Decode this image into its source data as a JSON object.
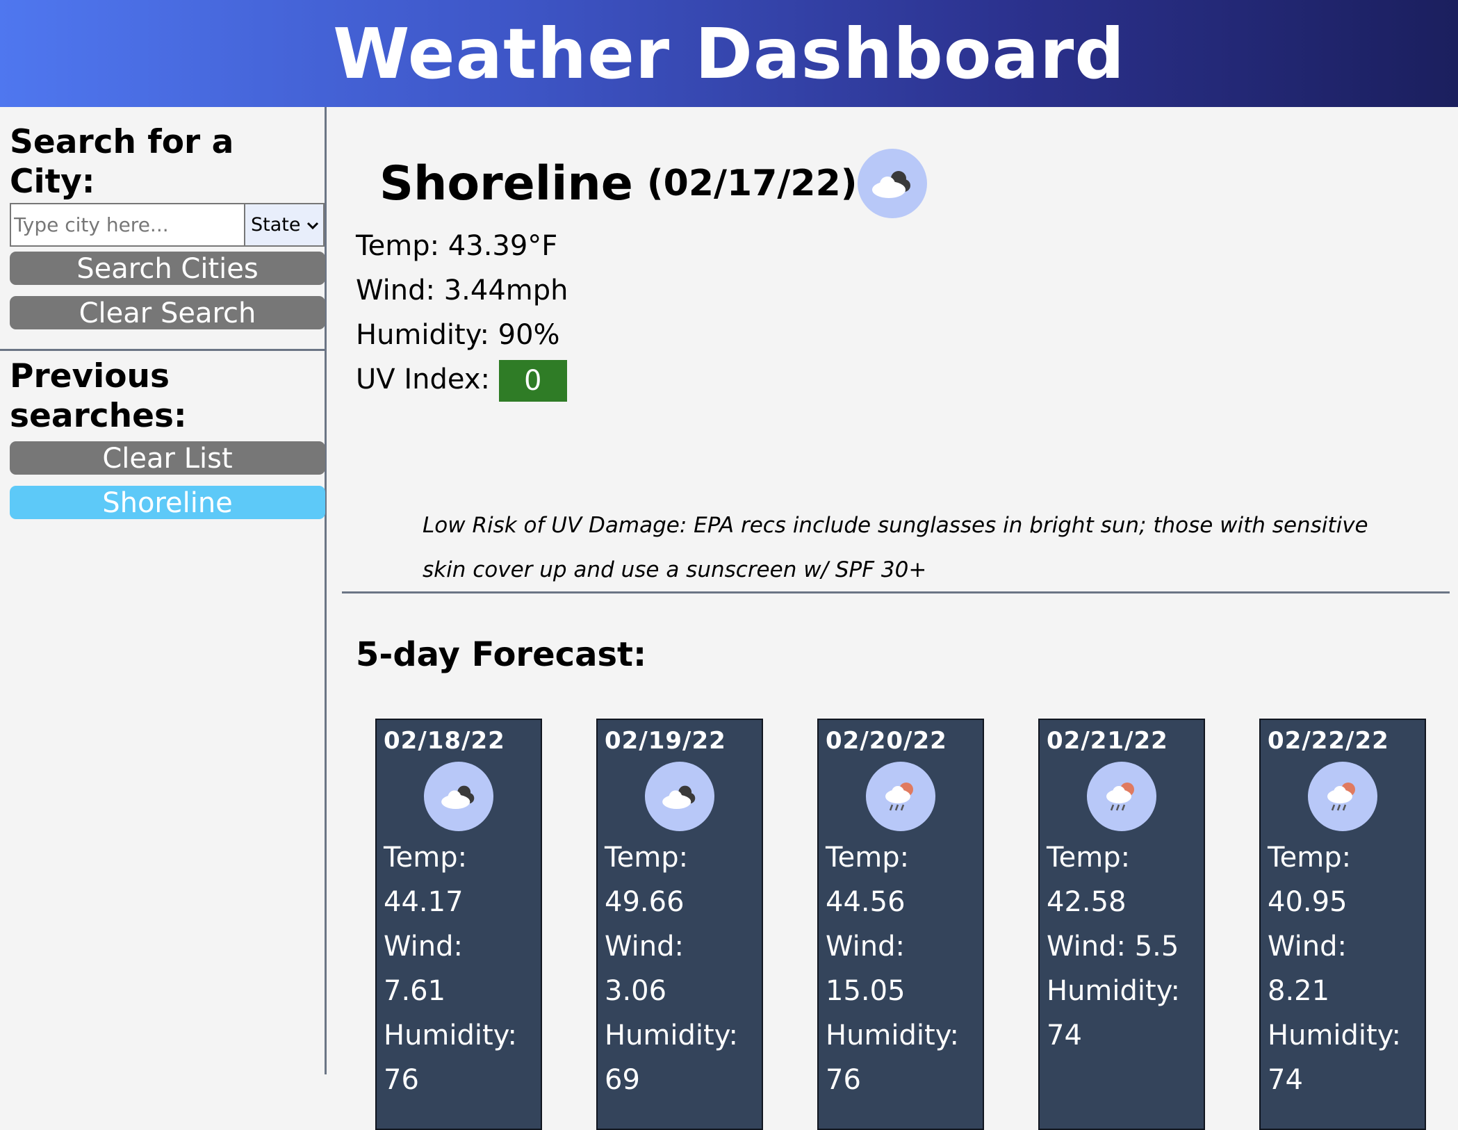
{
  "app_title": "Weather Dashboard",
  "sidebar": {
    "search_heading": "Search for a City:",
    "city_input_placeholder": "Type city here...",
    "city_input_value": "",
    "state_select_value": "State",
    "search_button": "Search Cities",
    "clear_search_button": "Clear Search",
    "previous_heading": "Previous searches:",
    "clear_list_button": "Clear List",
    "history": [
      "Shoreline"
    ]
  },
  "current": {
    "city": "Shoreline",
    "date": "(02/17/22)",
    "icon": "cloudy-night-icon",
    "temp": "Temp: 43.39°F",
    "wind": "Wind: 3.44mph",
    "humidity": "Humidity: 90%",
    "uv_label": "UV Index:",
    "uv_value": "0",
    "uv_color": "#2f7c26",
    "uv_note": "Low Risk of UV Damage: EPA recs include sunglasses in bright sun; those with sensitive skin cover up and use a sunscreen w/ SPF 30+"
  },
  "forecast_title": "5-day Forecast:",
  "forecast": [
    {
      "date": "02/18/22",
      "icon": "cloudy-night-icon",
      "lines": [
        "Temp:",
        "44.17",
        "Wind:",
        "7.61",
        "Humidity:",
        "76"
      ]
    },
    {
      "date": "02/19/22",
      "icon": "cloudy-night-icon",
      "lines": [
        "Temp:",
        "49.66",
        "Wind:",
        "3.06",
        "Humidity:",
        "69"
      ]
    },
    {
      "date": "02/20/22",
      "icon": "rain-sun-icon",
      "lines": [
        "Temp:",
        "44.56",
        "Wind:",
        "15.05",
        "Humidity:",
        "76"
      ]
    },
    {
      "date": "02/21/22",
      "icon": "rain-sun-icon",
      "lines": [
        "Temp:",
        "42.58",
        "Wind: 5.5",
        "Humidity:",
        "74"
      ]
    },
    {
      "date": "02/22/22",
      "icon": "rain-sun-icon",
      "lines": [
        "Temp:",
        "40.95",
        "Wind:",
        "8.21",
        "Humidity:",
        "74"
      ]
    }
  ]
}
